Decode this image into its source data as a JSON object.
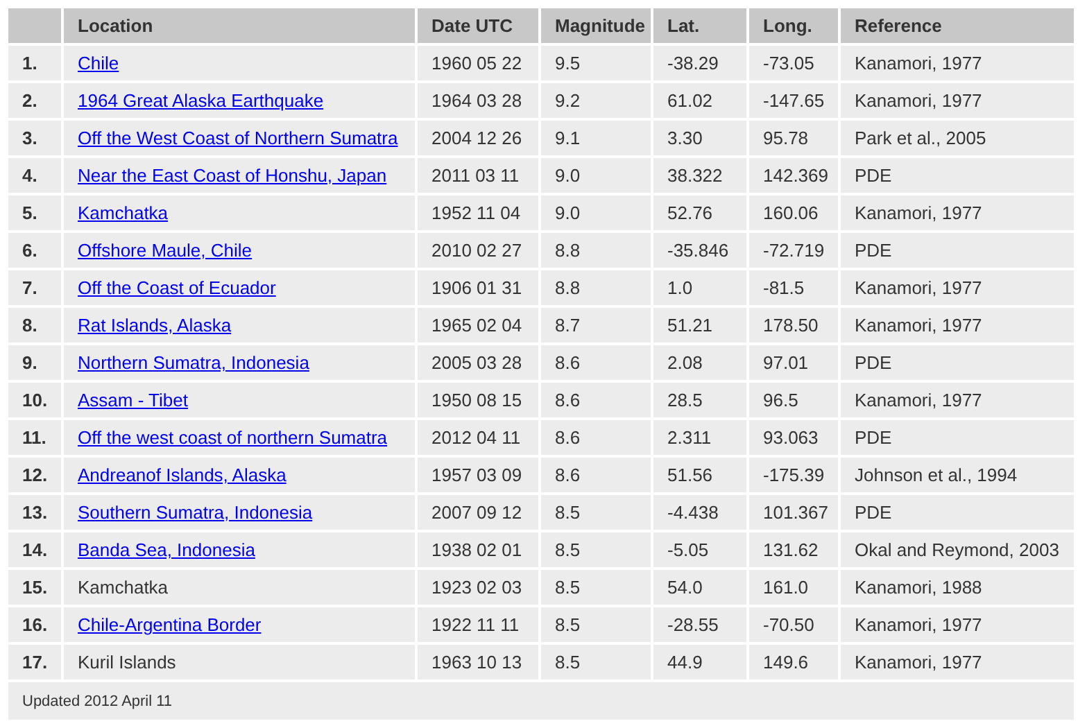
{
  "table": {
    "columns": [
      "Location",
      "Date UTC",
      "Magnitude",
      "Lat.",
      "Long.",
      "Reference"
    ],
    "rows": [
      {
        "rank": "1.",
        "location": "Chile",
        "linked": true,
        "date": "1960 05 22",
        "magnitude": "9.5",
        "lat": "-38.29",
        "long": "-73.05",
        "reference": "Kanamori, 1977"
      },
      {
        "rank": "2.",
        "location": "1964 Great Alaska Earthquake",
        "linked": true,
        "date": "1964 03 28",
        "magnitude": "9.2",
        "lat": "61.02",
        "long": "-147.65",
        "reference": "Kanamori, 1977"
      },
      {
        "rank": "3.",
        "location": "Off the West Coast of Northern Sumatra",
        "linked": true,
        "date": "2004 12 26",
        "magnitude": "9.1",
        "lat": "3.30",
        "long": "95.78",
        "reference": "Park et al., 2005"
      },
      {
        "rank": "4.",
        "location": "Near the East Coast of Honshu, Japan",
        "linked": true,
        "date": "2011 03 11",
        "magnitude": "9.0",
        "lat": "38.322",
        "long": "142.369",
        "reference": "PDE"
      },
      {
        "rank": "5.",
        "location": "Kamchatka",
        "linked": true,
        "date": "1952 11 04",
        "magnitude": "9.0",
        "lat": "52.76",
        "long": "160.06",
        "reference": "Kanamori, 1977"
      },
      {
        "rank": "6.",
        "location": "Offshore Maule, Chile",
        "linked": true,
        "date": "2010 02 27",
        "magnitude": "8.8",
        "lat": "-35.846",
        "long": "-72.719",
        "reference": "PDE"
      },
      {
        "rank": "7.",
        "location": "Off the Coast of Ecuador",
        "linked": true,
        "date": "1906 01 31",
        "magnitude": "8.8",
        "lat": "1.0",
        "long": "-81.5",
        "reference": "Kanamori, 1977"
      },
      {
        "rank": "8.",
        "location": "Rat Islands, Alaska",
        "linked": true,
        "date": "1965 02 04",
        "magnitude": "8.7",
        "lat": "51.21",
        "long": "178.50",
        "reference": "Kanamori, 1977"
      },
      {
        "rank": "9.",
        "location": "Northern Sumatra, Indonesia",
        "linked": true,
        "date": "2005 03 28",
        "magnitude": "8.6",
        "lat": "2.08",
        "long": "97.01",
        "reference": "PDE"
      },
      {
        "rank": "10.",
        "location": "Assam - Tibet",
        "linked": true,
        "date": "1950 08 15",
        "magnitude": "8.6",
        "lat": "28.5",
        "long": "96.5",
        "reference": "Kanamori, 1977"
      },
      {
        "rank": "11.",
        "location": "Off the west coast of northern Sumatra",
        "linked": true,
        "date": "2012 04 11",
        "magnitude": "8.6",
        "lat": "2.311",
        "long": "93.063",
        "reference": "PDE"
      },
      {
        "rank": "12.",
        "location": "Andreanof Islands, Alaska",
        "linked": true,
        "date": "1957 03 09",
        "magnitude": "8.6",
        "lat": "51.56",
        "long": "-175.39",
        "reference": "Johnson et al., 1994"
      },
      {
        "rank": "13.",
        "location": "Southern Sumatra, Indonesia",
        "linked": true,
        "date": "2007 09 12",
        "magnitude": "8.5",
        "lat": "-4.438",
        "long": "101.367",
        "reference": "PDE"
      },
      {
        "rank": "14.",
        "location": "Banda Sea, Indonesia",
        "linked": true,
        "date": "1938 02 01",
        "magnitude": "8.5",
        "lat": "-5.05",
        "long": "131.62",
        "reference": "Okal and Reymond, 2003"
      },
      {
        "rank": "15.",
        "location": "Kamchatka",
        "linked": false,
        "date": "1923 02 03",
        "magnitude": "8.5",
        "lat": "54.0",
        "long": "161.0",
        "reference": "Kanamori, 1988"
      },
      {
        "rank": "16.",
        "location": "Chile-Argentina Border",
        "linked": true,
        "date": "1922 11 11",
        "magnitude": "8.5",
        "lat": "-28.55",
        "long": "-70.50",
        "reference": "Kanamori, 1977"
      },
      {
        "rank": "17.",
        "location": "Kuril Islands",
        "linked": false,
        "date": "1963 10 13",
        "magnitude": "8.5",
        "lat": "44.9",
        "long": "149.6",
        "reference": "Kanamori, 1977"
      }
    ],
    "footer": "Updated 2012 April 11"
  }
}
